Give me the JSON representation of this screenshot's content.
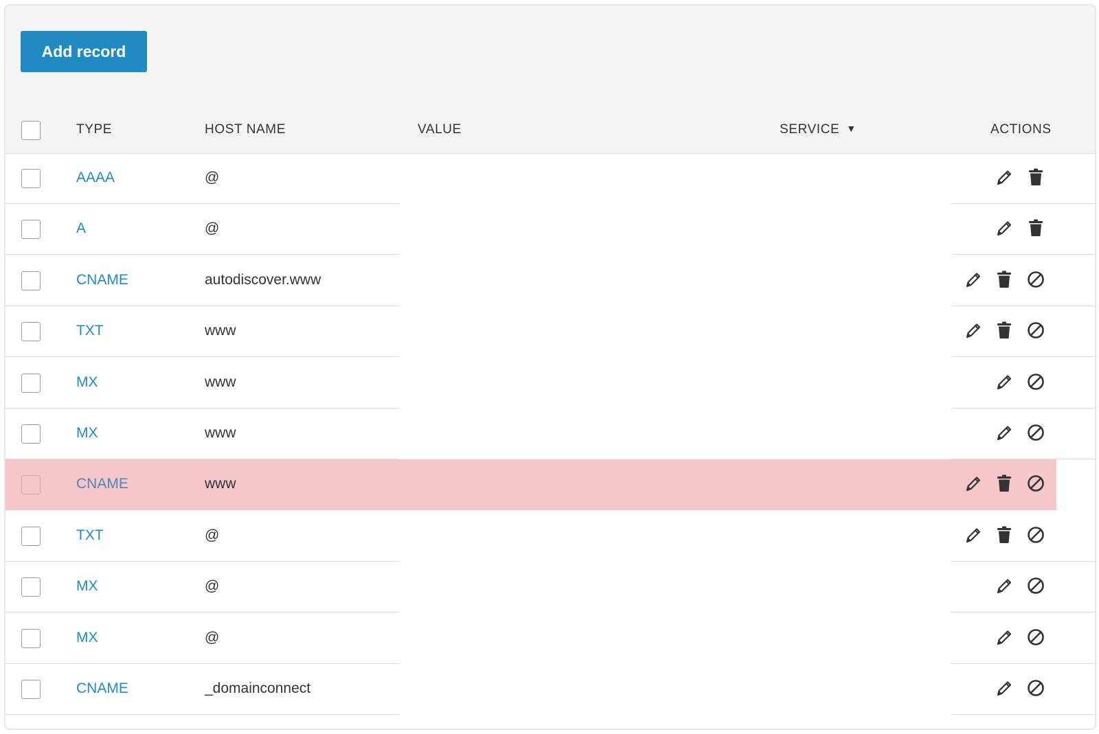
{
  "toolbar": {
    "add_record_label": "Add record"
  },
  "table": {
    "headers": {
      "type": "TYPE",
      "host_name": "HOST NAME",
      "value": "VALUE",
      "service": "SERVICE",
      "actions": "ACTIONS"
    },
    "service_sort_indicator": "▼",
    "rows": [
      {
        "type": "AAAA",
        "host": "@",
        "actions": [
          "edit",
          "delete"
        ],
        "highlighted": false
      },
      {
        "type": "A",
        "host": "@",
        "actions": [
          "edit",
          "delete"
        ],
        "highlighted": false
      },
      {
        "type": "CNAME",
        "host": "autodiscover.www",
        "actions": [
          "edit",
          "delete",
          "disable"
        ],
        "highlighted": false
      },
      {
        "type": "TXT",
        "host": "www",
        "actions": [
          "edit",
          "delete",
          "disable"
        ],
        "highlighted": false
      },
      {
        "type": "MX",
        "host": "www",
        "actions": [
          "edit",
          "disable"
        ],
        "highlighted": false
      },
      {
        "type": "MX",
        "host": "www",
        "actions": [
          "edit",
          "disable"
        ],
        "highlighted": false
      },
      {
        "type": "CNAME",
        "host": "www",
        "actions": [
          "edit",
          "delete",
          "disable"
        ],
        "highlighted": true
      },
      {
        "type": "TXT",
        "host": "@",
        "actions": [
          "edit",
          "delete",
          "disable"
        ],
        "highlighted": false
      },
      {
        "type": "MX",
        "host": "@",
        "actions": [
          "edit",
          "disable"
        ],
        "highlighted": false
      },
      {
        "type": "MX",
        "host": "@",
        "actions": [
          "edit",
          "disable"
        ],
        "highlighted": false
      },
      {
        "type": "CNAME",
        "host": "_domainconnect",
        "actions": [
          "edit",
          "disable"
        ],
        "highlighted": false
      }
    ]
  },
  "colors": {
    "accent": "#1f8bc2",
    "highlight_row": "#f5c7cb",
    "header_bg": "#f4f4f4",
    "icon": "#333333"
  }
}
